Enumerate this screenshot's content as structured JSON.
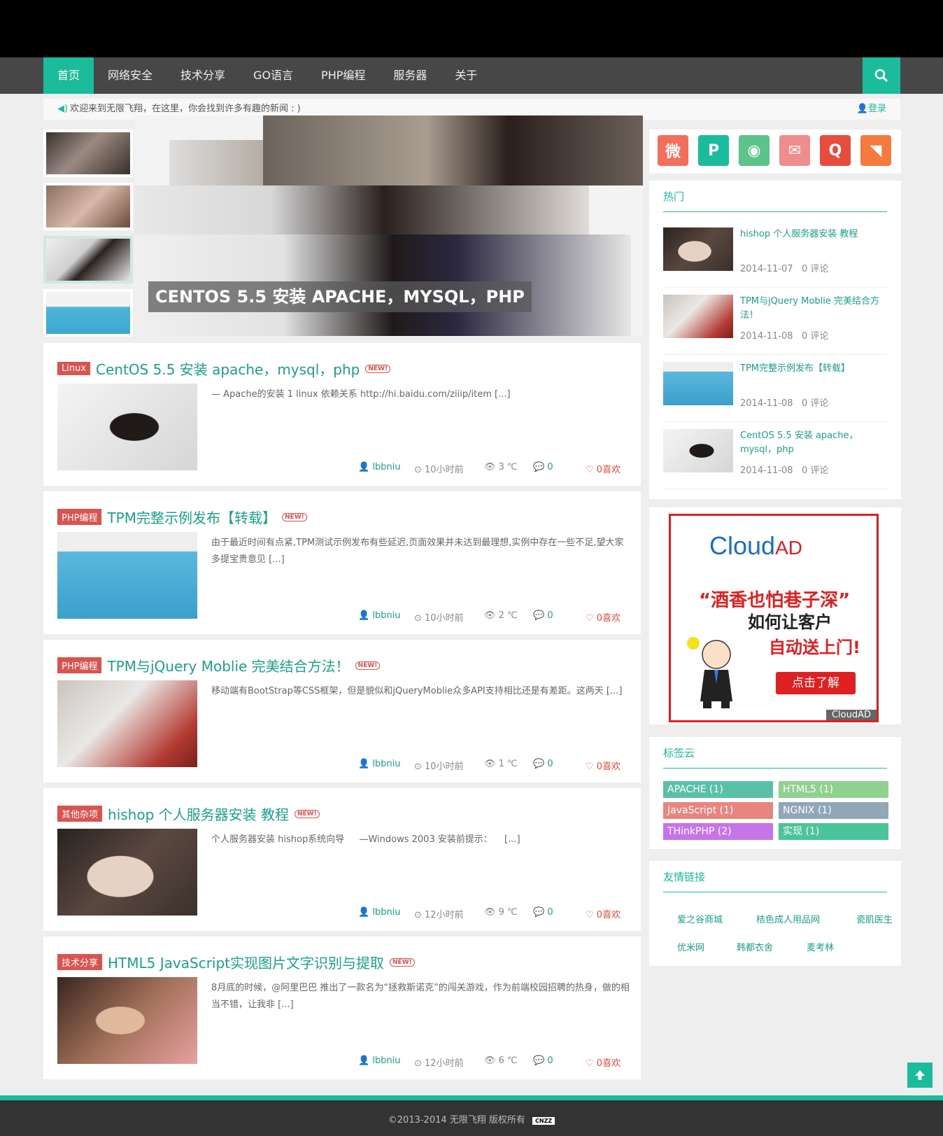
{
  "nav": {
    "items": [
      "首页",
      "网络安全",
      "技术分享",
      "GO语言",
      "PHP编程",
      "服务器",
      "关于"
    ],
    "active_index": 0
  },
  "welcome": {
    "text": "欢迎来到无限飞翔，在这里，你会找到许多有趣的新闻 : )",
    "login": "登录"
  },
  "slider": {
    "caption": "CENTOS 5.5 安装 APACHE，MYSQL，PHP"
  },
  "posts": [
    {
      "category": "Linux",
      "title": "CentOS 5.5 安装 apache，mysql，php",
      "badge": "NEW!",
      "excerpt": "— Apache的安装 1 linux 依赖关系 http://hi.baidu.com/ziiip/item [...]",
      "author": "lbbniu",
      "time": "10小时前",
      "views": "3 ℃",
      "comments": "0",
      "likes": "0喜欢"
    },
    {
      "category": "PHP编程",
      "title": "TPM完整示例发布【转载】",
      "badge": "NEW!",
      "excerpt": "由于最近时间有点紧,TPM测试示例发布有些延迟,页面效果并未达到最理想,实例中存在一些不足,望大家多提宝贵意见 [...]",
      "author": "lbbniu",
      "time": "10小时前",
      "views": "2 ℃",
      "comments": "0",
      "likes": "0喜欢"
    },
    {
      "category": "PHP编程",
      "title": "TPM与jQuery Moblie 完美结合方法！",
      "badge": "NEW!",
      "excerpt": "移动端有BootStrap等CSS框架，但是貌似和jQueryMoblie众多API支持相比还是有差距。这两天 [...]",
      "author": "lbbniu",
      "time": "10小时前",
      "views": "1 ℃",
      "comments": "0",
      "likes": "0喜欢"
    },
    {
      "category": "其他杂项",
      "title": "hishop 个人服务器安装 教程",
      "badge": "NEW!",
      "excerpt": "个人服务器安装 hishop系统向导 　 —Windows 2003 安装前提示： 　[...]",
      "author": "lbbniu",
      "time": "12小时前",
      "views": "9 ℃",
      "comments": "0",
      "likes": "0喜欢"
    },
    {
      "category": "技术分享",
      "title": "HTML5 JavaScript实现图片文字识别与提取",
      "badge": "NEW!",
      "excerpt": "8月底的时候，@阿里巴巴 推出了一款名为“拯救斯诺克”的闯关游戏，作为前端校园招聘的热身，做的相当不错，让我非 [...]",
      "author": "lbbniu",
      "time": "12小时前",
      "views": "6 ℃",
      "comments": "0",
      "likes": "0喜欢"
    }
  ],
  "social": [
    {
      "icon": "weibo-icon",
      "color": "#f36f5a",
      "glyph": "微"
    },
    {
      "icon": "tencent-weibo-icon",
      "color": "#1abc9c",
      "glyph": "P"
    },
    {
      "icon": "wechat-icon",
      "color": "#5cc38a",
      "glyph": "◉"
    },
    {
      "icon": "mail-icon",
      "color": "#ef8c8c",
      "glyph": "✉"
    },
    {
      "icon": "qq-icon",
      "color": "#e74c3c",
      "glyph": "Q"
    },
    {
      "icon": "rss-icon",
      "color": "#f47b3d",
      "glyph": "◥"
    }
  ],
  "hot": {
    "title": "热门",
    "items": [
      {
        "title": "hishop 个人服务器安装 教程",
        "date": "2014-11-07",
        "comments": "0 评论"
      },
      {
        "title": "TPM与jQuery Moblie 完美结合方法！",
        "date": "2014-11-08",
        "comments": "0 评论"
      },
      {
        "title": "TPM完整示例发布【转载】",
        "date": "2014-11-08",
        "comments": "0 评论"
      },
      {
        "title": "CentOS 5.5 安装 apache，mysql，php",
        "date": "2014-11-08",
        "comments": "0 评论"
      }
    ]
  },
  "ad": {
    "logo": "Cloud",
    "logo_ad": "AD",
    "line1": "“酒香也怕巷子深”",
    "line2": "如何让客户",
    "line3": "自动送上门!",
    "button": "点击了解",
    "footer": "CloudAD"
  },
  "tags": {
    "title": "标签云",
    "items": [
      {
        "label": "APACHE (1)",
        "color": "#5bc0a8"
      },
      {
        "label": "HTML5 (1)",
        "color": "#8fd18f"
      },
      {
        "label": "JavaScript (1)",
        "color": "#e8857f"
      },
      {
        "label": "NGNIX (1)",
        "color": "#8fa7b8"
      },
      {
        "label": "THinkPHP (2)",
        "color": "#c774e8"
      },
      {
        "label": "实现 (1)",
        "color": "#4cc49a"
      }
    ]
  },
  "links": {
    "title": "友情链接",
    "items": [
      "爱之谷商城",
      "桔色成人用品网",
      "瓷肌医生",
      "优米网",
      "韩都衣舍",
      "麦考林"
    ]
  },
  "footer": {
    "text": "©2013-2014 无限飞翔 版权所有",
    "cnzz": "CNZZ"
  }
}
